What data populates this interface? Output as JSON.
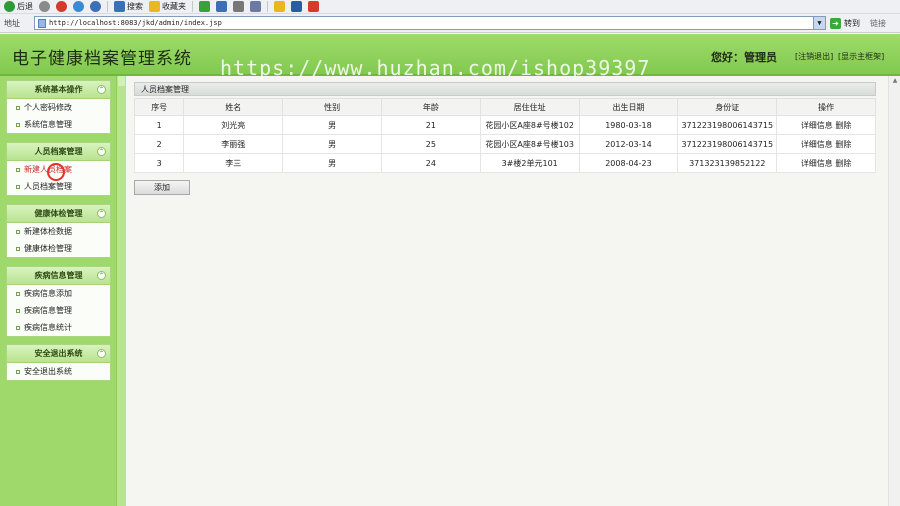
{
  "browser": {
    "toolbar": [
      {
        "label": "后退",
        "icon": "back-arrow-icon",
        "color": "#2e9a37"
      },
      {
        "label": "",
        "icon": "forward-arrow-icon",
        "color": "#8a8a8a"
      },
      {
        "label": "",
        "icon": "stop-icon",
        "color": "#d33a2a"
      },
      {
        "label": "",
        "icon": "refresh-icon",
        "color": "#3b8ad4"
      },
      {
        "label": "",
        "icon": "home-icon",
        "color": "#3b6fb6"
      },
      {
        "label": "搜索",
        "icon": "search-icon",
        "color": "#3b6fb6"
      },
      {
        "label": "收藏夹",
        "icon": "favorites-star-icon",
        "color": "#e8b820"
      },
      {
        "label": "",
        "icon": "history-icon",
        "color": "#3aa03a"
      },
      {
        "label": "",
        "icon": "mail-icon",
        "color": "#3b6fb6"
      },
      {
        "label": "",
        "icon": "print-icon",
        "color": "#777777"
      },
      {
        "label": "",
        "icon": "edit-icon",
        "color": "#6b7aa4"
      },
      {
        "label": "",
        "icon": "folder-icon",
        "color": "#e8b820"
      },
      {
        "label": "",
        "icon": "messenger-icon",
        "color": "#2a5ca0"
      },
      {
        "label": "",
        "icon": "app-icon",
        "color": "#d63b2a"
      }
    ],
    "address_label": "地址",
    "url": "http://localhost:8083/jkd/admin/index.jsp",
    "go_label": "转到",
    "links_label": "链接"
  },
  "header": {
    "title": "电子健康档案管理系统",
    "greeting": "您好：管理员",
    "logout": "[注销退出]",
    "show_frame": "[显示主框架]",
    "watermark": "https://www.huzhan.com/ishop39397"
  },
  "sidebar": {
    "groups": [
      {
        "title": "系统基本操作",
        "items": [
          "个人密码修改",
          "系统信息管理"
        ]
      },
      {
        "title": "人员档案管理",
        "items": [
          "新建人员档案",
          "人员档案管理"
        ]
      },
      {
        "title": "健康体检管理",
        "items": [
          "新建体检数据",
          "健康体检管理"
        ]
      },
      {
        "title": "疾病信息管理",
        "items": [
          "疾病信息添加",
          "疾病信息管理",
          "疾病信息统计"
        ]
      },
      {
        "title": "安全退出系统",
        "items": [
          "安全退出系统"
        ]
      }
    ]
  },
  "main": {
    "panel_title": "人员档案管理",
    "columns": [
      "序号",
      "姓名",
      "性别",
      "年龄",
      "居住住址",
      "出生日期",
      "身份证",
      "操作"
    ],
    "rows": [
      {
        "no": "1",
        "name": "刘光亮",
        "gender": "男",
        "age": "21",
        "address": "花园小区A座8#号楼102",
        "birth": "1980-03-18",
        "id_card": "371223198006143715",
        "detail": "详细信息",
        "delete": "删除"
      },
      {
        "no": "2",
        "name": "李丽强",
        "gender": "男",
        "age": "25",
        "address": "花园小区A座8#号楼103",
        "birth": "2012-03-14",
        "id_card": "371223198006143715",
        "detail": "详细信息",
        "delete": "删除"
      },
      {
        "no": "3",
        "name": "李三",
        "gender": "男",
        "age": "24",
        "address": "3#楼2单元101",
        "birth": "2008-04-23",
        "id_card": "371323139852122",
        "detail": "详细信息",
        "delete": "删除"
      }
    ],
    "add_label": "添加"
  }
}
